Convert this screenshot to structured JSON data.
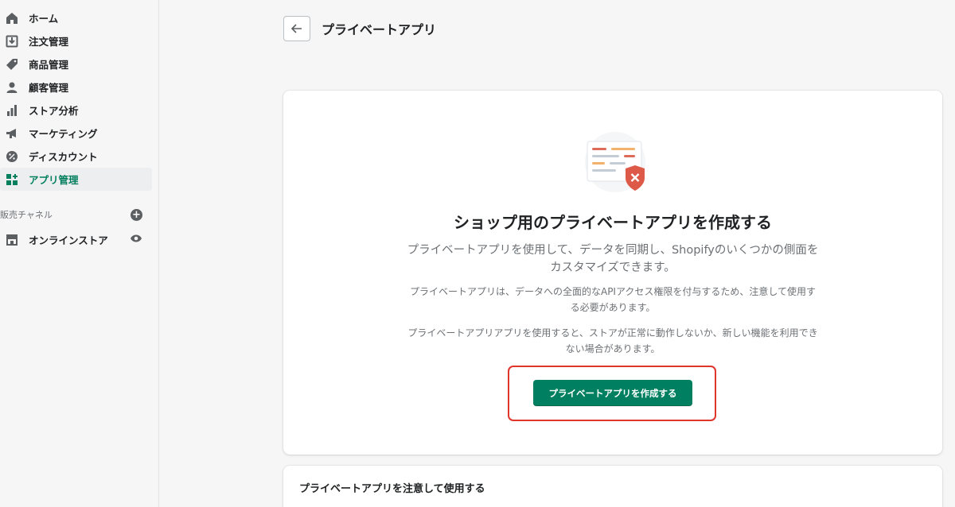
{
  "sidebar": {
    "items": [
      {
        "label": "ホーム",
        "icon": "home-icon"
      },
      {
        "label": "注文管理",
        "icon": "orders-icon"
      },
      {
        "label": "商品管理",
        "icon": "tag-icon"
      },
      {
        "label": "顧客管理",
        "icon": "customer-icon"
      },
      {
        "label": "ストア分析",
        "icon": "analytics-icon"
      },
      {
        "label": "マーケティング",
        "icon": "megaphone-icon"
      },
      {
        "label": "ディスカウント",
        "icon": "discount-icon"
      },
      {
        "label": "アプリ管理",
        "icon": "apps-icon",
        "active": true
      }
    ],
    "channels_header": "販売チャネル",
    "channels": [
      {
        "label": "オンラインストア",
        "icon": "store-icon"
      }
    ]
  },
  "header": {
    "title": "プライベートアプリ"
  },
  "card": {
    "heading": "ショップ用のプライベートアプリを作成する",
    "subtitle": "プライベートアプリを使用して、データを同期し、Shopifyのいくつかの側面をカスタマイズできます。",
    "paragraph1": "プライベートアプリは、データへの全面的なAPIアクセス権限を付与するため、注意して使用する必要があります。",
    "paragraph2": "プライベートアプリアプリを使用すると、ストアが正常に動作しないか、新しい機能を利用できない場合があります。",
    "button_label": "プライベートアプリを作成する"
  },
  "card2": {
    "title": "プライベートアプリを注意して使用する"
  },
  "colors": {
    "accent": "#008060",
    "highlight": "#e0352b",
    "active_nav": "#007f5f"
  }
}
